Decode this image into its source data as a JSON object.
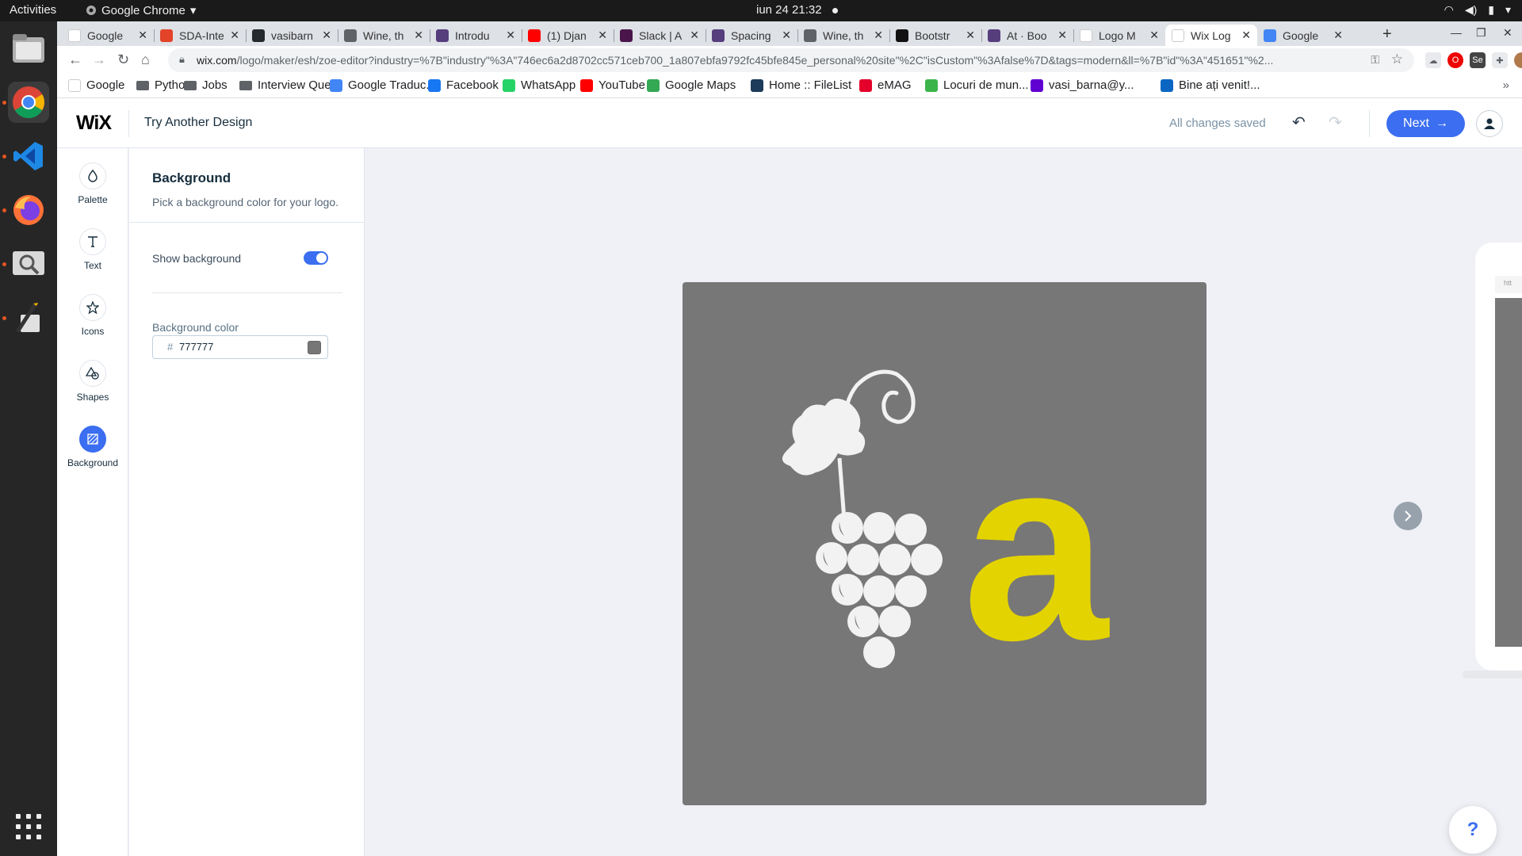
{
  "os": {
    "activities": "Activities",
    "app_name": "Google Chrome",
    "clock": "iun 24  21:32"
  },
  "browser": {
    "tabs": [
      {
        "label": "Google",
        "icon": "google-favicon",
        "color": "#ffffff"
      },
      {
        "label": "SDA-Inte",
        "icon": "gitlab-favicon",
        "color": "#e24329"
      },
      {
        "label": "vasibarn",
        "icon": "github-favicon",
        "color": "#24292e"
      },
      {
        "label": "Wine, th",
        "icon": "globe-favicon",
        "color": "#5f6368"
      },
      {
        "label": "Introdu",
        "icon": "bootstrap-favicon",
        "color": "#563d7c"
      },
      {
        "label": "(1) Djan",
        "icon": "youtube-favicon",
        "color": "#ff0000"
      },
      {
        "label": "Slack | A",
        "icon": "slack-favicon",
        "color": "#4a154b"
      },
      {
        "label": "Spacing",
        "icon": "bootstrap-favicon",
        "color": "#563d7c"
      },
      {
        "label": "Wine, th",
        "icon": "globe-favicon",
        "color": "#5f6368"
      },
      {
        "label": "Bootstr",
        "icon": "a-favicon",
        "color": "#111111"
      },
      {
        "label": "At · Boo",
        "icon": "bootstrap-favicon",
        "color": "#563d7c"
      },
      {
        "label": "Logo M",
        "icon": "wix-favicon",
        "color": "#ffffff"
      },
      {
        "label": "Wix Log",
        "icon": "wix-favicon",
        "color": "#ffffff"
      },
      {
        "label": "Google",
        "icon": "google-translate-favicon",
        "color": "#4285f4"
      }
    ],
    "new_tab": "+",
    "url_host": "wix.com",
    "url_path": "/logo/maker/esh/zoe-editor?industry=%7B\"industry\"%3A\"746ec6a2d8702cc571ceb700_1a807ebfa9792fc45bfe845e_personal%20site\"%2C\"isCustom\"%3Afalse%7D&tags=modern&ll=%7B\"id\"%3A\"451651\"%2...",
    "bookmarks": [
      {
        "label": "Google",
        "icon": "google-favicon",
        "color": "#ffffff"
      },
      {
        "label": "Python",
        "icon": "folder-icon",
        "color": "#5f6368"
      },
      {
        "label": "Jobs",
        "icon": "folder-icon",
        "color": "#5f6368"
      },
      {
        "label": "Interview Que...",
        "icon": "folder-icon",
        "color": "#5f6368"
      },
      {
        "label": "Google Traduc...",
        "icon": "google-translate-favicon",
        "color": "#4285f4"
      },
      {
        "label": "Facebook",
        "icon": "facebook-favicon",
        "color": "#1877f2"
      },
      {
        "label": "WhatsApp",
        "icon": "whatsapp-favicon",
        "color": "#25d366"
      },
      {
        "label": "YouTube",
        "icon": "youtube-favicon",
        "color": "#ff0000"
      },
      {
        "label": "Google Maps",
        "icon": "maps-favicon",
        "color": "#34a853"
      },
      {
        "label": "Home :: FileList",
        "icon": "filelist-favicon",
        "color": "#1d3b5a"
      },
      {
        "label": "eMAG",
        "icon": "emag-favicon",
        "color": "#e4002b"
      },
      {
        "label": "Locuri de mun...",
        "icon": "ejobs-favicon",
        "color": "#3bb54a"
      },
      {
        "label": "vasi_barna@y...",
        "icon": "yahoo-mail-favicon",
        "color": "#6001d2"
      },
      {
        "label": "Bine ați venit!...",
        "icon": "linkedin-favicon",
        "color": "#0a66c2"
      }
    ],
    "bookmarks_more": "»"
  },
  "wix": {
    "logo": "WiX",
    "try_another": "Try Another Design",
    "saved_status": "All changes saved",
    "next_label": "Next",
    "rail": [
      {
        "label": "Palette",
        "icon": "palette-drop-icon"
      },
      {
        "label": "Text",
        "icon": "text-icon"
      },
      {
        "label": "Icons",
        "icon": "star-icon"
      },
      {
        "label": "Shapes",
        "icon": "shapes-icon"
      },
      {
        "label": "Background",
        "icon": "background-icon"
      }
    ],
    "panel": {
      "title": "Background",
      "subtitle": "Pick a background color for your logo.",
      "show_background_label": "Show background",
      "show_background": true,
      "bg_color_label": "Background color",
      "bg_color_hash": "#",
      "bg_color_value": "777777"
    },
    "logo_preview": {
      "background": "#777777",
      "letter": "a",
      "letter_color": "#e3d300",
      "icon": "grapes-icon",
      "icon_color": "#f2f2f2"
    },
    "device_url_hint": "htt",
    "help_label": "?"
  },
  "colors": {
    "accent": "#3b6ef0",
    "panel_text": "#162d3d"
  }
}
